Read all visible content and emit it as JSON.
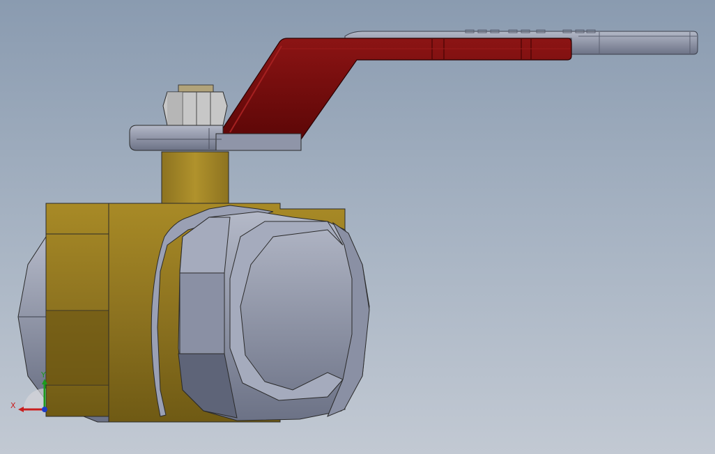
{
  "viewport": {
    "model": "ball-valve",
    "colors": {
      "background_top": "#8a9bb0",
      "background_bottom": "#c2c9d3",
      "brass": "#a88a26",
      "brass_dark": "#6f5a14",
      "steel": "#9aa0b4",
      "steel_dark": "#6c7286",
      "handle_red": "#6e0a0a",
      "handle_red_light": "#8c1414",
      "edge": "#2a2a2a"
    }
  },
  "triad": {
    "x_label": "X",
    "y_label": "Y",
    "x_color": "#c81e1e",
    "y_color": "#1e9a1e",
    "z_color": "#1e3cc8"
  }
}
